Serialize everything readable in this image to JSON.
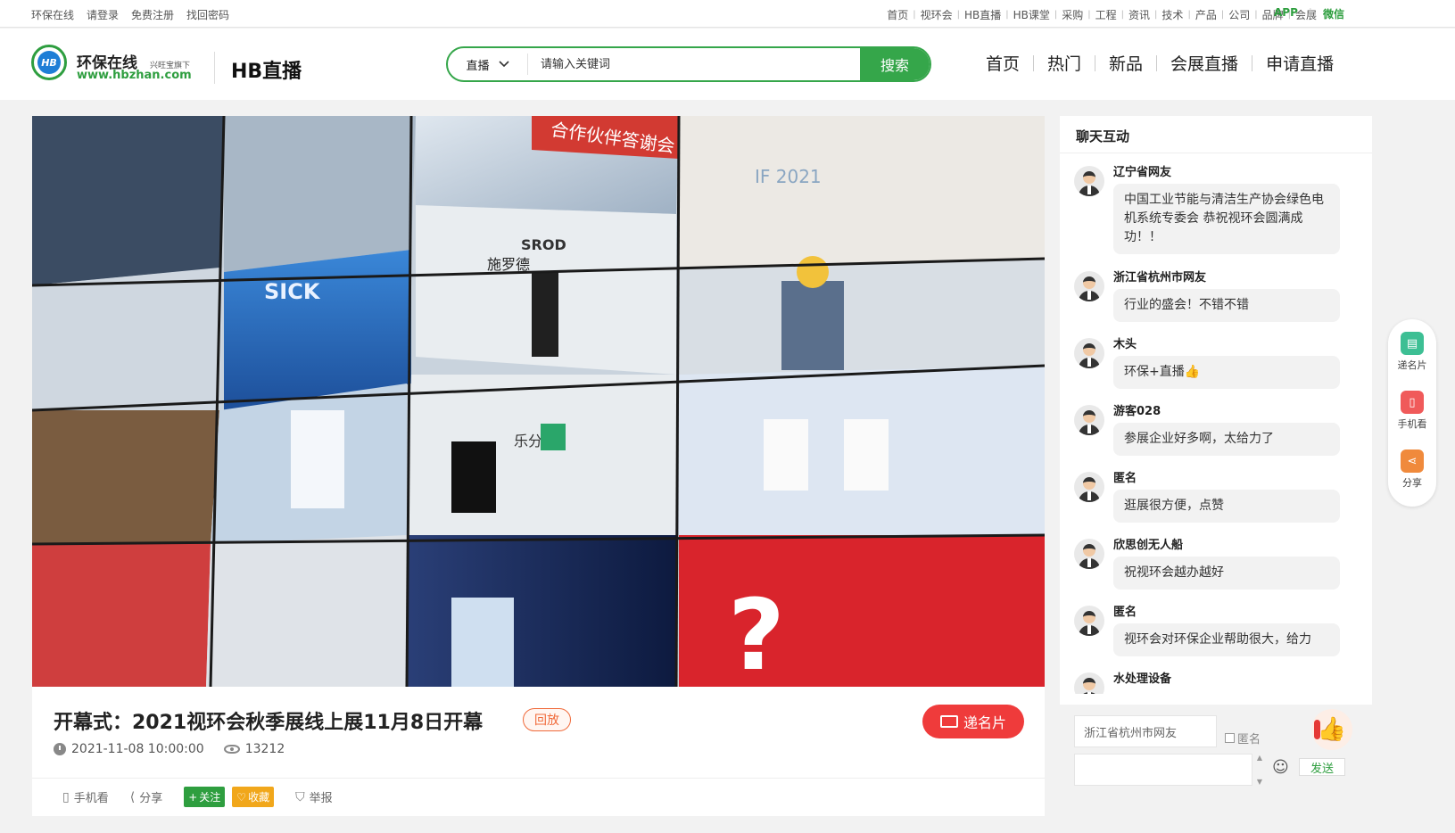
{
  "topbar": {
    "left_links": [
      "环保在线",
      "请登录",
      "免费注册",
      "找回密码"
    ],
    "right_links": [
      "首页",
      "视环会",
      "HB直播",
      "HB课堂",
      "采购",
      "工程",
      "资讯",
      "技术",
      "产品",
      "公司",
      "品牌",
      "会展"
    ],
    "app": "APP",
    "wechat": "微信"
  },
  "header": {
    "logo_letters": "HB",
    "brand_name": "环保在线",
    "brand_sub": "兴旺宝旗下",
    "brand_url": "www.hbzhan.com",
    "site_title": "HB直播",
    "search": {
      "type": "直播",
      "placeholder": "请输入关键词",
      "button": "搜索"
    },
    "nav": [
      "首页",
      "热门",
      "新品",
      "会展直播",
      "申请直播"
    ]
  },
  "video": {
    "banner_text": "合作伙伴答谢会",
    "brand_marks": [
      "SROD",
      "施罗德",
      "SICK",
      "乐分美",
      "IF 2021"
    ]
  },
  "live": {
    "title": "开幕式：2021视环会秋季展线上展11月8日开幕",
    "badge": "回放",
    "card_button": "递名片",
    "datetime": "2021-11-08 10:00:00",
    "views": "13212",
    "actions": {
      "mobile": "手机看",
      "share": "分享",
      "follow": "关注",
      "favorite": "收藏",
      "report": "举报"
    }
  },
  "chat": {
    "title": "聊天互动",
    "messages": [
      {
        "name": "辽宁省网友",
        "text": "中国工业节能与清洁生产协会绿色电机系统专委会 恭祝视环会圆满成功！！"
      },
      {
        "name": "浙江省杭州市网友",
        "text": "行业的盛会！不错不错"
      },
      {
        "name": "木头",
        "text": "环保+直播👍"
      },
      {
        "name": "游客028",
        "text": "参展企业好多啊，太给力了"
      },
      {
        "name": "匿名",
        "text": "逛展很方便，点赞"
      },
      {
        "name": "欣思创无人船",
        "text": "祝视环会越办越好"
      },
      {
        "name": "匿名",
        "text": "视环会对环保企业帮助很大，给力"
      },
      {
        "name": "水处理设备",
        "text": ""
      }
    ],
    "nickname": "浙江省杭州市网友",
    "anonymous_label": "匿名",
    "send": "发送"
  },
  "sidebar": {
    "items": [
      {
        "label": "递名片",
        "icon": "card-icon",
        "color": "#3dbf94"
      },
      {
        "label": "手机看",
        "icon": "phone-icon",
        "color": "#f05a5a"
      },
      {
        "label": "分享",
        "icon": "share-icon",
        "color": "#f08a3c"
      }
    ]
  },
  "colors": {
    "brand_green": "#35a64a",
    "accent_red": "#ef3b3b",
    "badge_orange": "#f06a3a"
  }
}
